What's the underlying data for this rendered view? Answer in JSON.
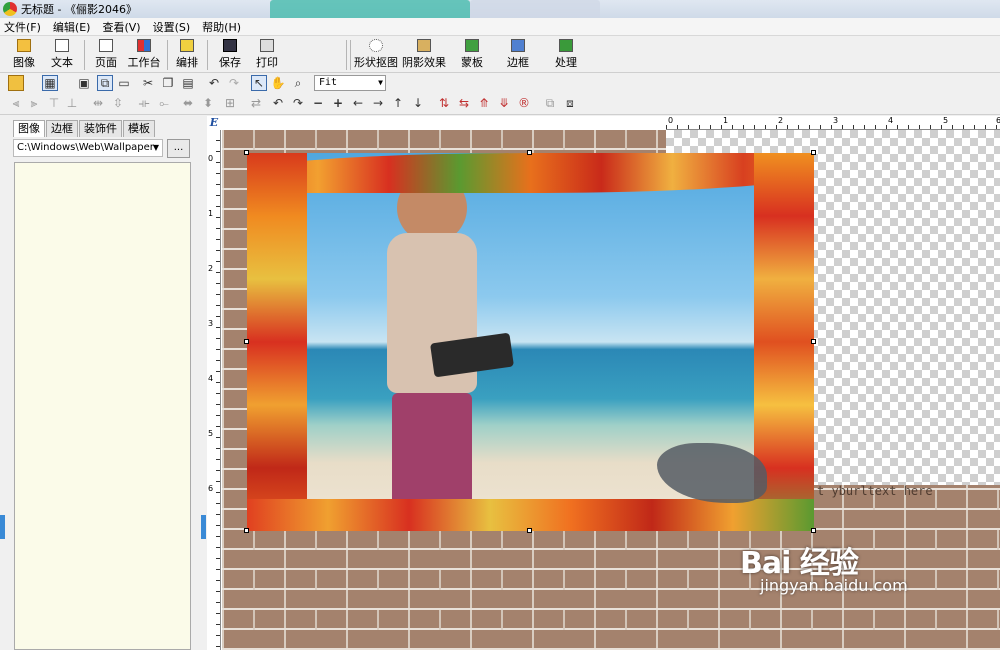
{
  "window": {
    "title": "无标题 - 《俪影2046》"
  },
  "menu": [
    "文件(F)",
    "编辑(E)",
    "查看(V)",
    "设置(S)",
    "帮助(H)"
  ],
  "toolbar_main": [
    {
      "label": "图像",
      "icon": "image-icon"
    },
    {
      "label": "文本",
      "icon": "text-icon"
    },
    {
      "label": "页面",
      "icon": "page-icon"
    },
    {
      "label": "工作台",
      "icon": "workbench-icon"
    },
    {
      "label": "编排",
      "icon": "arrange-icon"
    },
    {
      "label": "保存",
      "icon": "save-icon"
    },
    {
      "label": "打印",
      "icon": "print-icon"
    },
    {
      "label": "形状抠图",
      "icon": "shape-cutout-icon"
    },
    {
      "label": "阴影效果",
      "icon": "shadow-effect-icon"
    },
    {
      "label": "蒙板",
      "icon": "mask-icon"
    },
    {
      "label": "边框",
      "icon": "border-icon"
    },
    {
      "label": "处理",
      "icon": "process-icon"
    }
  ],
  "zoom": {
    "value": "Fit"
  },
  "left_panel": {
    "tabs": [
      "图像",
      "边框",
      "装饰件",
      "模板"
    ],
    "active_tab": "图像",
    "path": "C:\\Windows\\Web\\Wallpaper",
    "browse_label": "..."
  },
  "rulers": {
    "horizontal": [
      "0",
      "1",
      "2",
      "3",
      "4",
      "5",
      "6"
    ],
    "vertical": [
      "0",
      "1",
      "2",
      "3",
      "4",
      "5",
      "6"
    ]
  },
  "canvas": {
    "overlay_text": "t yburltext here"
  },
  "watermark": {
    "brand": "Bai 经验",
    "url": "jingyan.baidu.com"
  },
  "colors": {
    "accent": "#3a8ad6",
    "panel_bg": "#fbfbe9"
  }
}
